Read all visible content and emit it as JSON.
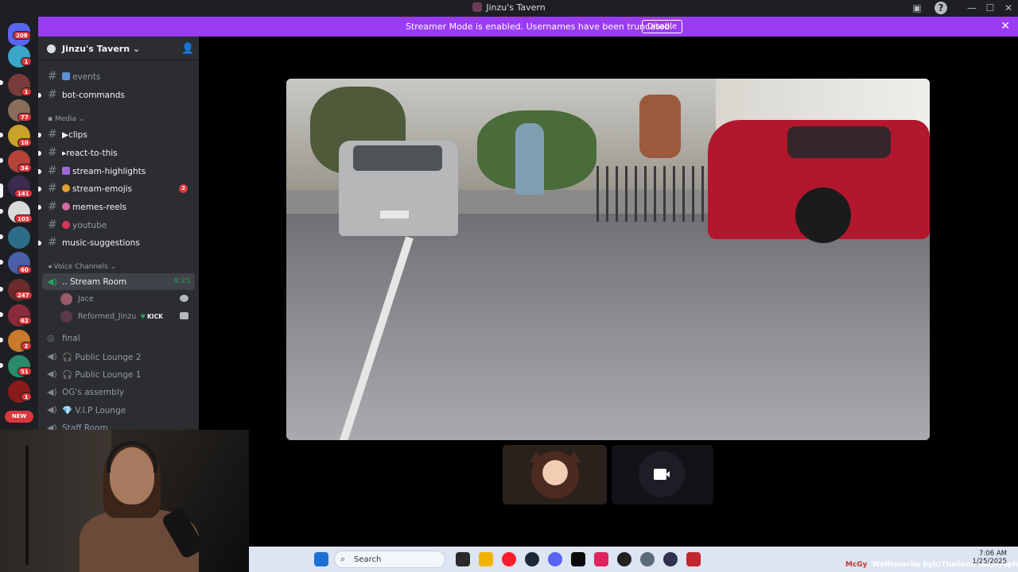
{
  "window": {
    "title": "Jinzu's Tavern",
    "controls": {
      "minimize": "—",
      "maximize": "☐",
      "close": "✕",
      "help": "?"
    }
  },
  "banner": {
    "message": "Streamer Mode is enabled. Usernames have been truncated.",
    "disable_label": "Disable",
    "close": "✕",
    "color": "#9b3cf4"
  },
  "rail": {
    "servers": [
      {
        "badge": "208",
        "color": "#5865f2"
      },
      {
        "badge": "1",
        "color": "#3aa6c9"
      },
      {
        "badge": "1",
        "color": "#7a3b3b"
      },
      {
        "badge": "77",
        "color": "#8a6d5b"
      },
      {
        "badge": "10",
        "color": "#c9a227"
      },
      {
        "badge": "34",
        "color": "#b5433a"
      },
      {
        "badge": "141",
        "color": "#3b2b4f"
      },
      {
        "badge": "103",
        "color": "#d9d9d9"
      },
      {
        "badge": "",
        "color": "#2c6e8a"
      },
      {
        "badge": "60",
        "color": "#4b5fa8"
      },
      {
        "badge": "247",
        "color": "#6b2b2b"
      },
      {
        "badge": "62",
        "color": "#8a2b3b"
      },
      {
        "badge": "2",
        "color": "#c97a2b"
      },
      {
        "badge": "51",
        "color": "#2b8a6b"
      },
      {
        "badge": "1",
        "color": "#8a1b1b"
      }
    ],
    "new_label": "NEW"
  },
  "sidebar": {
    "server_name": "Jinzu's Tavern",
    "channels_top": [
      {
        "label": "events",
        "emoji_color": "#5d8fd8",
        "unread": false
      },
      {
        "label": "bot-commands",
        "emoji_color": "",
        "unread": true
      }
    ],
    "media_category": "Media",
    "media_channels": [
      {
        "label": "▶clips",
        "emoji_color": "",
        "unread": true,
        "mentions": ""
      },
      {
        "label": "▸react-to-this",
        "emoji_color": "",
        "unread": true,
        "mentions": ""
      },
      {
        "label": "stream-highlights",
        "emoji_color": "#9b6ad8",
        "unread": true,
        "mentions": ""
      },
      {
        "label": "stream-emojis",
        "emoji_color": "#e0a030",
        "unread": true,
        "mentions": "2"
      },
      {
        "label": "memes-reels",
        "emoji_color": "#d86aa0",
        "unread": true,
        "mentions": ""
      },
      {
        "label": "youtube",
        "emoji_color": "#e0345a",
        "unread": false,
        "mentions": ""
      },
      {
        "label": "music-suggestions",
        "emoji_color": "",
        "unread": true,
        "mentions": ""
      }
    ],
    "voice_category": "Voice Channels",
    "stream_room": {
      "label": "Stream Room",
      "time": "8:25"
    },
    "voice_users": [
      {
        "name": "Jace",
        "tag": "",
        "avatar_color": "#9b5a6a"
      },
      {
        "name": "Reformed_Jinzu",
        "tag": "KICK",
        "avatar_color": "#5a3a4a"
      }
    ],
    "voice_channels": [
      {
        "label": "final",
        "emoji": ""
      },
      {
        "label": "Public Lounge 2",
        "emoji": "🎧"
      },
      {
        "label": "Public Lounge 1",
        "emoji": "🎧"
      },
      {
        "label": "OG's assembly",
        "emoji": ""
      },
      {
        "label": "V.I.P Lounge",
        "emoji": "💎"
      },
      {
        "label": "Staff Room",
        "emoji": ""
      }
    ]
  },
  "taskbar": {
    "search_placeholder": "Search",
    "ticker_user": "McGy",
    "ticker_text": "Wolfrumche byh!Thailand mapiyaphotos",
    "time": "7:06 AM",
    "date": "1/25/2025"
  }
}
